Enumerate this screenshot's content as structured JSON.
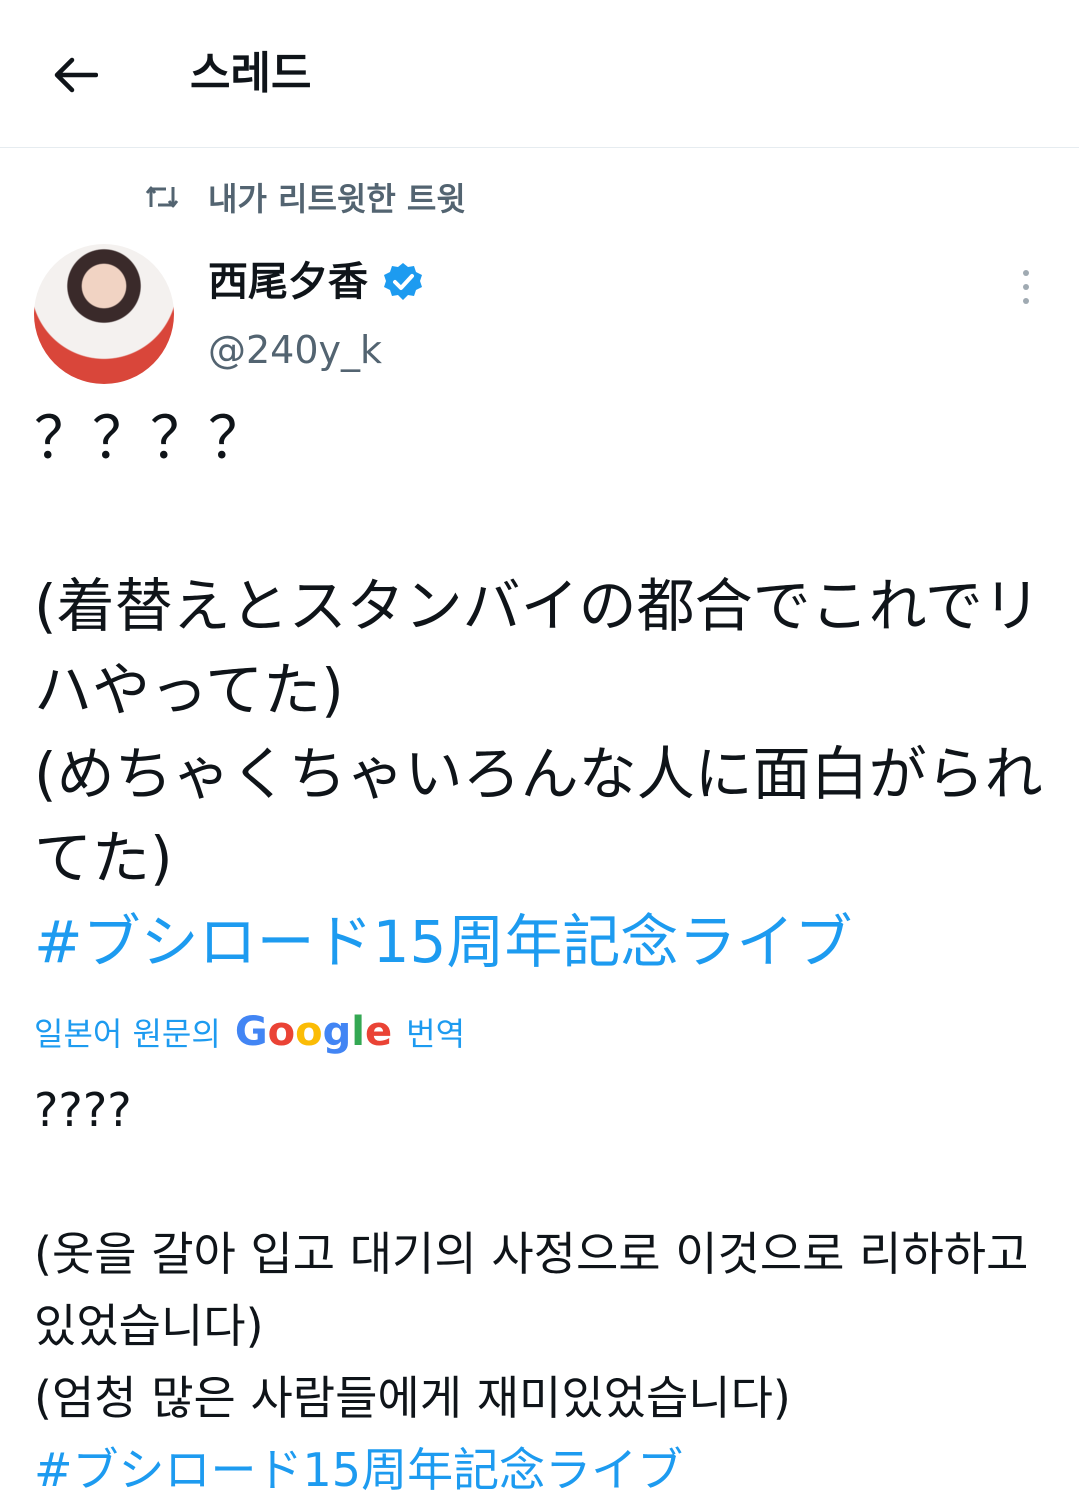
{
  "header": {
    "title": "스레드",
    "back_icon": "arrow-left-icon"
  },
  "retweet_context": {
    "label": "내가 리트윗한 트윗",
    "icon": "retweet-icon"
  },
  "author": {
    "name": "西尾夕香",
    "handle": "@240y_k",
    "verified": true,
    "verified_color": "#1d9bf0"
  },
  "tweet": {
    "line1": "？？？？",
    "line2": "",
    "line3": "(着替えとスタンバイの都合でこれでリハやってた)",
    "line4": "(めちゃくちゃいろんな人に面白がられてた)",
    "hashtag": "#ブシロード15周年記念ライブ"
  },
  "translation": {
    "label_prefix": "일본어 원문의",
    "label_suffix": "번역",
    "google_letters": [
      "G",
      "o",
      "o",
      "g",
      "l",
      "e"
    ],
    "google_colors": [
      "#4285F4",
      "#EA4335",
      "#FBBC05",
      "#4285F4",
      "#34A853",
      "#EA4335"
    ],
    "line1": "????",
    "line2": "",
    "line3": "(옷을 갈아 입고 대기의 사정으로 이것으로 리하하고있었습니다)",
    "line4": "(엄청 많은 사람들에게 재미있었습니다)",
    "hashtag": "#ブシロード15周年記念ライブ"
  },
  "colors": {
    "accent": "#1d9bf0",
    "secondary_text": "#536471"
  }
}
